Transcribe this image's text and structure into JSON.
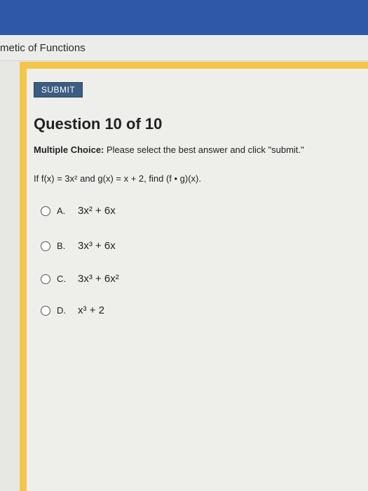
{
  "page": {
    "title": "metic of Functions"
  },
  "toolbar": {
    "submit_label": "SUBMIT"
  },
  "question": {
    "heading": "Question 10 of 10",
    "instruction_label": "Multiple Choice:",
    "instruction_text": " Please select the best answer and click \"submit.\"",
    "prompt": "If f(x) = 3x² and g(x) = x + 2, find (f • g)(x)."
  },
  "choices": [
    {
      "letter": "A.",
      "expression": "3x² + 6x"
    },
    {
      "letter": "B.",
      "expression": "3x³ + 6x"
    },
    {
      "letter": "C.",
      "expression": "3x³ + 6x²"
    },
    {
      "letter": "D.",
      "expression": "x³ + 2"
    }
  ],
  "colors": {
    "header": "#2f59a8",
    "accent_border": "#f3c64a",
    "submit_button": "#3c5d82"
  }
}
